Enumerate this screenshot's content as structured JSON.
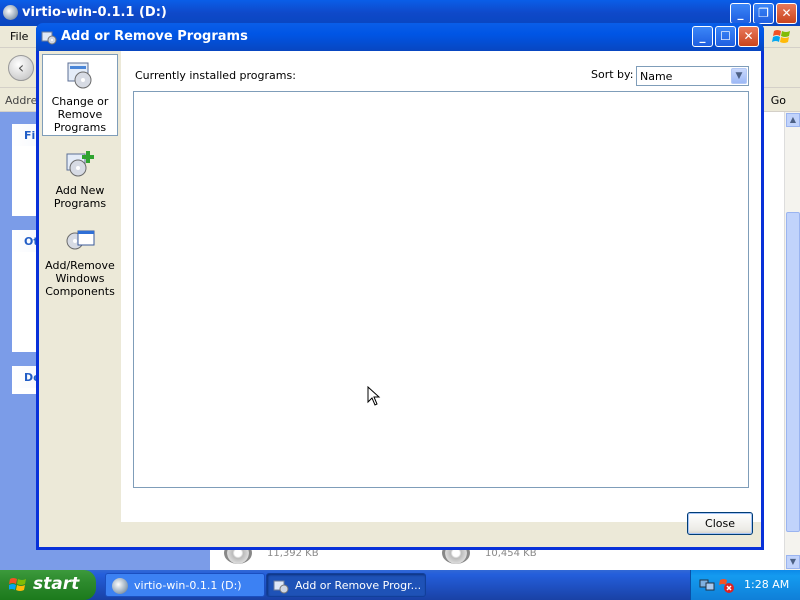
{
  "explorer": {
    "title": "virtio-win-0.1.1 (D:)",
    "menu_file": "File",
    "address_label": "Address",
    "go_label": "Go",
    "task_boxes": [
      {
        "header": "Fi"
      },
      {
        "header": "Ot"
      },
      {
        "header": "De"
      }
    ],
    "files": [
      {
        "size": "11,392 KB"
      },
      {
        "size": "10,454 KB"
      }
    ]
  },
  "dialog": {
    "title": "Add or Remove Programs",
    "nav": [
      {
        "label_line1": "Change or",
        "label_line2": "Remove",
        "label_line3": "Programs"
      },
      {
        "label_line1": "Add New",
        "label_line2": "Programs"
      },
      {
        "label_line1": "Add/Remove",
        "label_line2": "Windows",
        "label_line3": "Components"
      }
    ],
    "currently_installed_label": "Currently installed programs:",
    "sort_by_label": "Sort by:",
    "sort_by_value": "Name",
    "close_label": "Close"
  },
  "taskbar": {
    "start_label": "start",
    "tasks": [
      {
        "label": "virtio-win-0.1.1 (D:)"
      },
      {
        "label": "Add or Remove Progr..."
      }
    ],
    "clock": "1:28 AM"
  },
  "colors": {
    "titlebar_blue": "#0055e5",
    "start_green": "#2d8a2d",
    "tray_blue": "#149bf0",
    "dialog_face": "#ece9d8"
  }
}
